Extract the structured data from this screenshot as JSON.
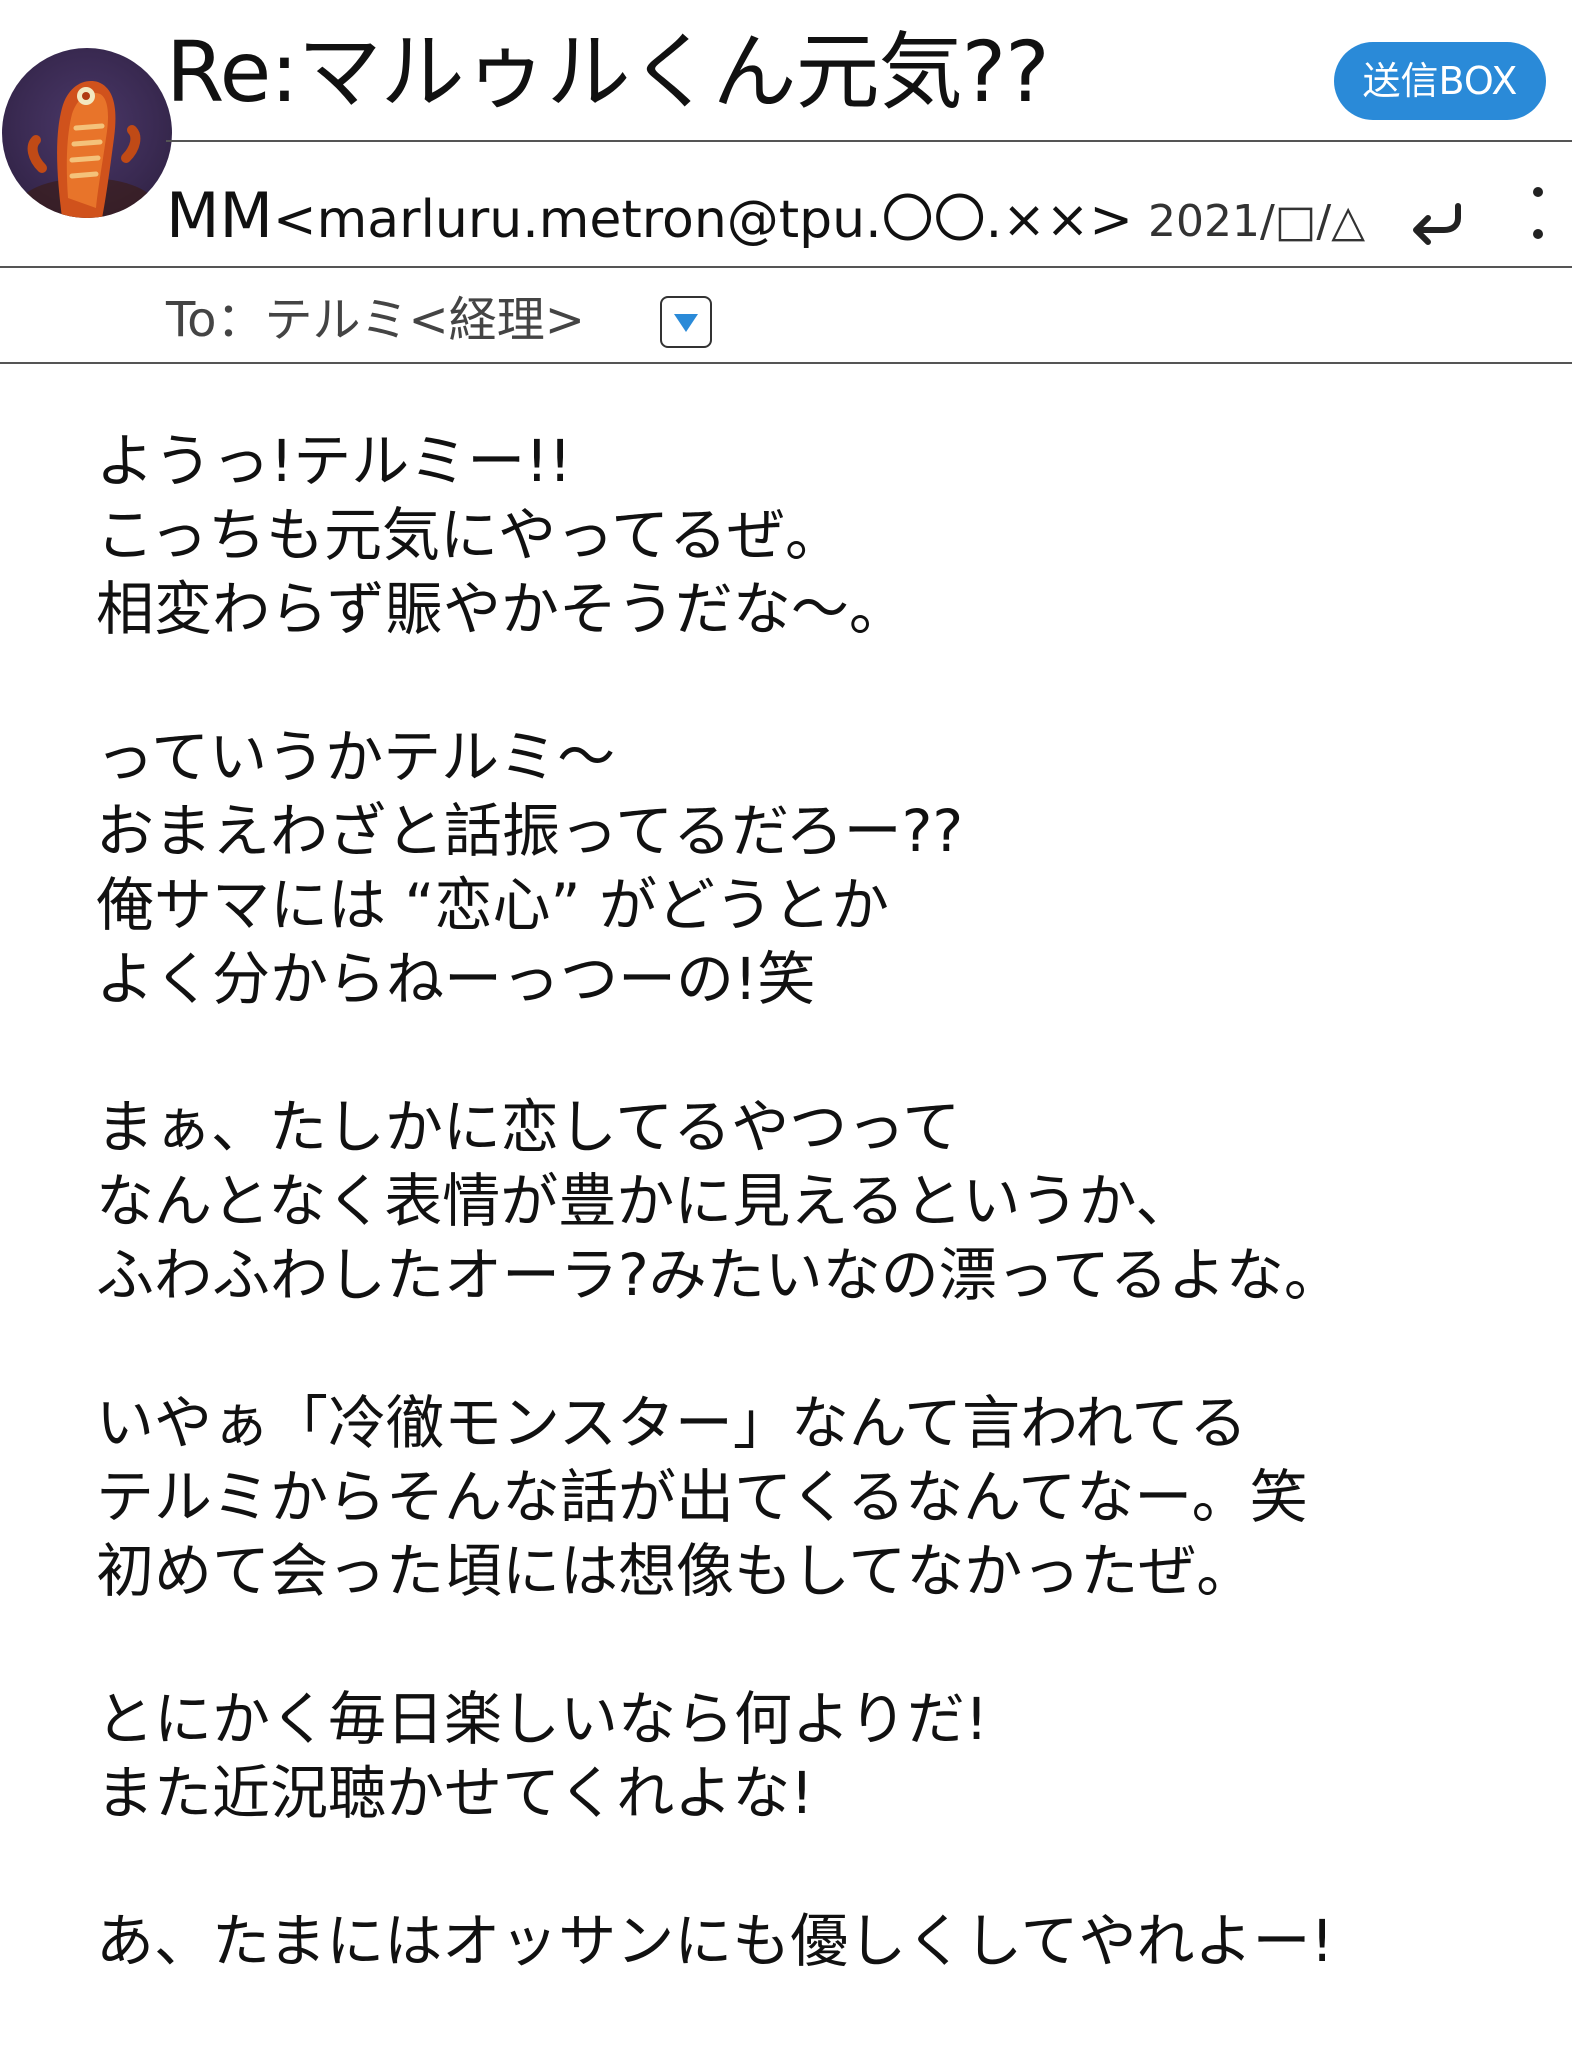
{
  "header": {
    "subject": "Re:マルゥルくん元気??",
    "send_box_label": "送信BOX"
  },
  "sender": {
    "name": "MM",
    "address": "<marluru.metron@tpu.〇〇.××>",
    "date": "2021/□/△"
  },
  "recipient": {
    "to_text": "To：テルミ<経理>"
  },
  "icons": {
    "avatar": "avatar-photo",
    "reply": "reply-arrow-icon",
    "more": "more-vertical-icon",
    "expand": "expand-triangle-icon"
  },
  "colors": {
    "accent": "#2a8ad8",
    "text": "#111111",
    "rule": "#555555"
  },
  "body": {
    "paragraphs": [
      [
        "ようっ!テルミー!!",
        "こっちも元気にやってるぜ。",
        "相変わらず賑やかそうだな〜。"
      ],
      [
        "っていうかテルミ〜",
        "おまえわざと話振ってるだろー??",
        "俺サマには “恋心” がどうとか",
        "よく分からねーっつーの!笑"
      ],
      [
        "まぁ、たしかに恋してるやつって",
        "なんとなく表情が豊かに見えるというか、",
        "ふわふわしたオーラ?みたいなの漂ってるよな。"
      ],
      [
        "いやぁ「冷徹モンスター」なんて言われてる",
        "テルミからそんな話が出てくるなんてなー。笑",
        "初めて会った頃には想像もしてなかったぜ。"
      ],
      [
        "とにかく毎日楽しいなら何よりだ!",
        "また近況聴かせてくれよな!"
      ],
      [
        "あ、たまにはオッサンにも優しくしてやれよー!"
      ]
    ]
  }
}
